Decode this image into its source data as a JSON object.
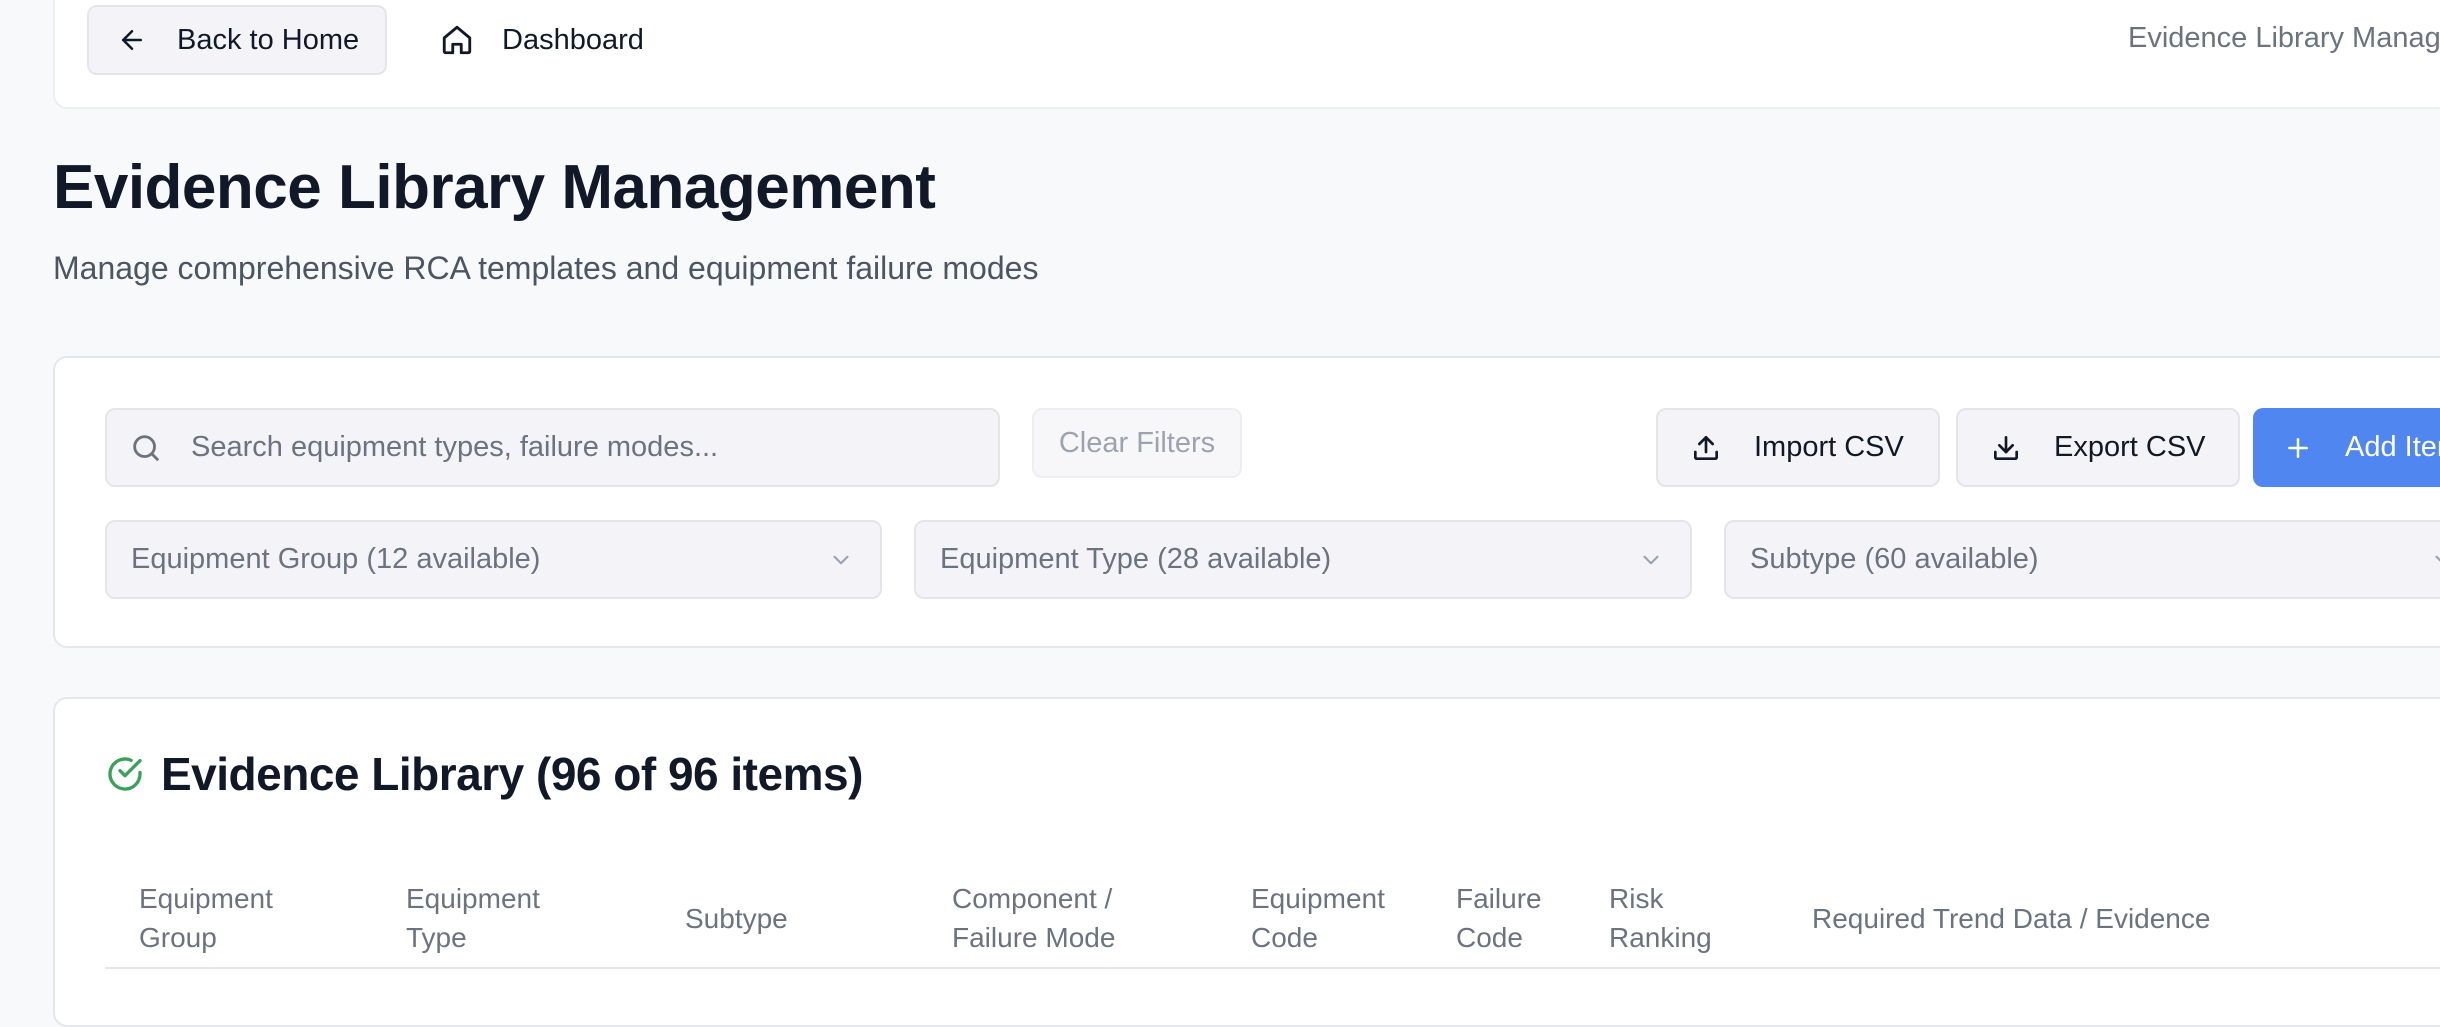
{
  "topbar": {
    "back_label": "Back to Home",
    "dashboard_label": "Dashboard",
    "page_label": "Evidence Library Management"
  },
  "header": {
    "title": "Evidence Library Management",
    "subtitle": "Manage comprehensive RCA templates and equipment failure modes"
  },
  "filters": {
    "search_placeholder": "Search equipment types, failure modes...",
    "search_value": "",
    "clear_label": "Clear Filters",
    "import_label": "Import CSV",
    "export_label": "Export CSV",
    "add_label": "Add Item",
    "equipment_group": "Equipment Group (12 available)",
    "equipment_type": "Equipment Type (28 available)",
    "subtype": "Subtype (60 available)"
  },
  "library": {
    "title": "Evidence Library (96 of 96 items)",
    "columns": [
      "Equipment\nGroup",
      "Equipment\nType",
      "Subtype",
      "Component /\nFailure Mode",
      "Equipment\nCode",
      "Failure\nCode",
      "Risk\nRanking",
      "Required Trend Data / Evidence"
    ]
  },
  "colors": {
    "accent": "#4f86f0",
    "success": "#3aa05a",
    "background": "#f8f9fb"
  },
  "icons": {
    "back": "arrow-left-icon",
    "dashboard": "home-icon",
    "search": "search-icon",
    "import": "upload-icon",
    "export": "download-icon",
    "add": "plus-icon",
    "dropdown": "chevron-down-icon",
    "library": "check-circle-icon"
  }
}
